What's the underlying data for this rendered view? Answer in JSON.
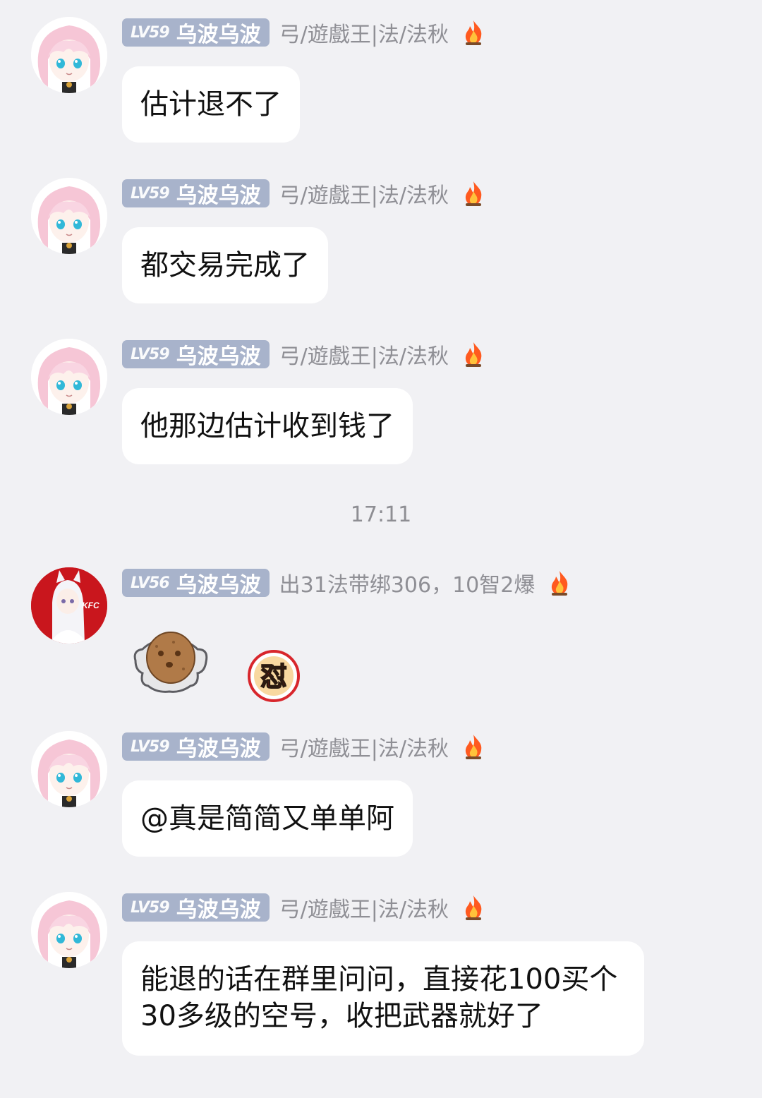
{
  "messages": [
    {
      "level": "LV59",
      "name": "乌波乌波",
      "title": "弓/遊戲王|法/法秋",
      "text": "估计退不了"
    },
    {
      "level": "LV59",
      "name": "乌波乌波",
      "title": "弓/遊戲王|法/法秋",
      "text": "都交易完成了"
    },
    {
      "level": "LV59",
      "name": "乌波乌波",
      "title": "弓/遊戲王|法/法秋",
      "text": "他那边估计收到钱了"
    },
    {
      "level": "LV56",
      "name": "乌波乌波",
      "title": "出31法带绑306，10智2爆",
      "avatar_text": "KFC"
    },
    {
      "level": "LV59",
      "name": "乌波乌波",
      "title": "弓/遊戲王|法/法秋",
      "text": "@真是简简又单单阿"
    },
    {
      "level": "LV59",
      "name": "乌波乌波",
      "title": "弓/遊戲王|法/法秋",
      "text": "能退的话在群里问问，直接花100买个30多级的空号，收把武器就好了"
    }
  ],
  "timestamp": "17:11",
  "sticker_text": "怼",
  "colors": {
    "background": "#f1f1f4",
    "bubble": "#ffffff",
    "badge": "#a8b3cb",
    "title": "#8f8f95"
  }
}
